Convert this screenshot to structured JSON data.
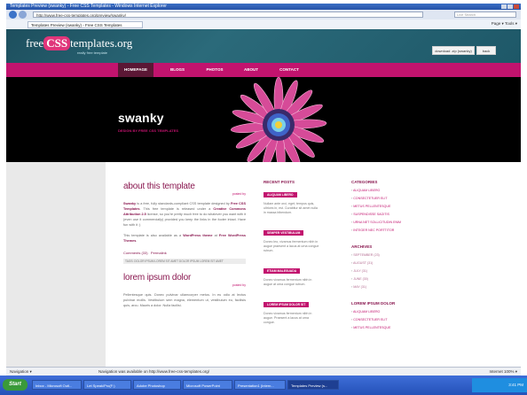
{
  "browser": {
    "title": "Templates Preview (swanky) - Free CSS Templates - Windows Internet Explorer",
    "address": "http://www.free-css-templates.org/preview/swanky/",
    "search_placeholder": "Live Search",
    "tab_label": "Templates Preview (swanky) - Free CSS Templates",
    "tab_tools": "Page ▾   Tools ▾"
  },
  "site": {
    "logo_left": "free",
    "logo_mid": "CSS",
    "logo_right": "templates.org",
    "tagline": "really free template",
    "download_label": "download .zip (swanky)",
    "back_label": "back",
    "title": "swanky",
    "subtitle": "DESIGN BY FREE CSS TEMPLATES",
    "menu": [
      "HOMEPAGE",
      "BLOGS",
      "PHOTOS",
      "ABOUT",
      "CONTACT"
    ]
  },
  "posts": [
    {
      "title": "about this template",
      "byline": "posted by",
      "p1_a": "Swanky",
      "p1_b": " is a free, fully standards-compliant CSS template designed by ",
      "p1_c": "Free CSS Templates",
      "p1_d": ". This free template is released under a ",
      "p1_e": "Creative Commons Attribution 2.5",
      "p1_f": " license, so you're pretty much free to do whatever you want with it (even use it commercially) provided you keep the links in the footer intact. Have fun with it :)",
      "p2_a": "This template is also available as a ",
      "p2_b": "WordPress theme",
      "p2_c": " at ",
      "p2_d": "Free WordPress Themes",
      "p2_e": ".",
      "comments": "Comments (33)",
      "permalink": "Permalink",
      "metabar": "TAGS: DOLOR IPSUM LOREM SIT AMET DOLOR IPSUM LOREM SIT AMET"
    },
    {
      "title": "lorem ipsum dolor",
      "byline": "posted by",
      "text": "Pellentesque quis. Donec pulvinar ullamcorper metus. In eu odio at lectus pulvinar mollis. Vestibulum sem magna, elementum ut, vestibulum eu, facilisis quis, arcu. Mauris a dolor. Nulla facilisi."
    }
  ],
  "recent": {
    "heading": "RECENT POSTS",
    "items": [
      {
        "label": "ALIQUAM LIBERO",
        "text": "Nullam ante orci, eget, tempus quis, ultrices in, est. Curabitur sit amet nulla in massa bibendum."
      },
      {
        "label": "SEMPER VESTIBULUM",
        "text": "Donec leo, vivamus fermentum nibh in augue praesent a lacus at urna congue rutrum."
      },
      {
        "label": "ETIAM MALESUADA",
        "text": "Donec vivamus fermentum nibh in augue at urna congue rutrum."
      },
      {
        "label": "LOREM IPSUM DOLOR SIT",
        "text": "Donec vivamus fermentum nibh in augue. Praesent a lacus at urna congue."
      }
    ]
  },
  "categories": {
    "heading": "CATEGORIES",
    "items": [
      "ALIQUAM LIBERO",
      "CONSECTETUER ELIT",
      "METUS PELLENTESQUE",
      "SUSPENDISSE SAGITIS",
      "URNA NET SOLLICITUDIN ENIM",
      "INTEGER NEC PORTTITOR"
    ]
  },
  "archives": {
    "heading": "ARCHIVES",
    "items": [
      "SEPTEMBER (23)",
      "AUGUST (31)",
      "JULY (31)",
      "JUNE (30)",
      "MAY (31)"
    ]
  },
  "lorem_list": {
    "heading": "LOREM IPSUM DOLOR",
    "items": [
      "ALIQUAM LIBERO",
      "CONSECTETUER ELIT",
      "METUS PELLENTESQUE"
    ]
  },
  "statusbar": {
    "left": "Navigation ▾",
    "message": "Navigation was available on http://www.free-css-templates.org/",
    "right": "Internet   100% ▾"
  },
  "taskbar": {
    "start": "Start",
    "items": [
      "Inbox - Microsoft Outl...",
      "Let Speak/Pro(F:)",
      "Adobe Photoshop",
      "Microsoft PowerPoint",
      "Presentation1 (Intern...",
      "Templates Preview (s..."
    ],
    "clock": "3:41 PM"
  },
  "colors": {
    "accent": "#c2136e",
    "header": "#1d4f5e",
    "menu_active": "#5b1735"
  }
}
